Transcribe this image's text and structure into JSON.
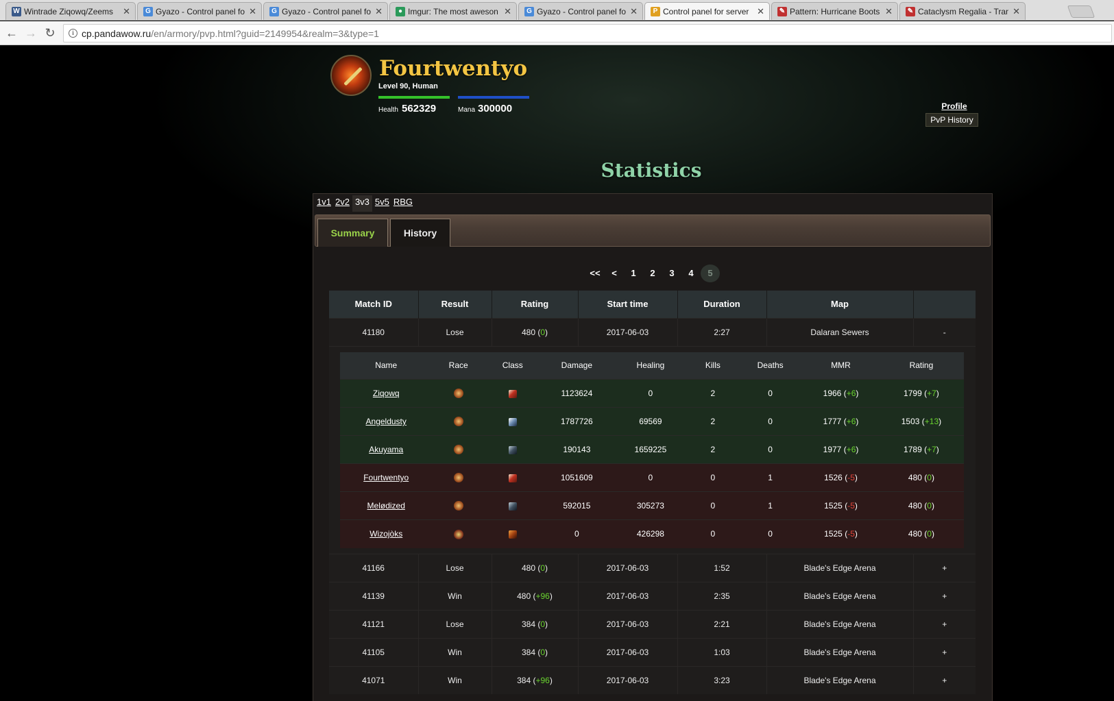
{
  "browser": {
    "tabs": [
      {
        "title": "Wintrade Ziqowq/Zeems",
        "favicon_color": "#3a5a8a",
        "glyph": "W",
        "active": false
      },
      {
        "title": "Gyazo - Control panel fo",
        "favicon_color": "#4a8ad8",
        "glyph": "G",
        "active": false
      },
      {
        "title": "Gyazo - Control panel fo",
        "favicon_color": "#4a8ad8",
        "glyph": "G",
        "active": false
      },
      {
        "title": "Imgur: The most aweson",
        "favicon_color": "#2a9a5a",
        "glyph": "●",
        "active": false
      },
      {
        "title": "Gyazo - Control panel fo",
        "favicon_color": "#4a8ad8",
        "glyph": "G",
        "active": false
      },
      {
        "title": "Control panel for server",
        "favicon_color": "#e0a020",
        "glyph": "P",
        "active": true
      },
      {
        "title": "Pattern: Hurricane Boots",
        "favicon_color": "#c03030",
        "glyph": "✎",
        "active": false
      },
      {
        "title": "Cataclysm Regalia - Tran",
        "favicon_color": "#c03030",
        "glyph": "✎",
        "active": false
      }
    ],
    "url_host": "cp.pandawow.ru",
    "url_path": "/en/armory/pvp.html?guid=2149954&realm=3&type=1"
  },
  "character": {
    "name": "Fourtwentyo",
    "subtitle": "Level 90, Human",
    "health_label": "Health",
    "health_value": "562329",
    "mana_label": "Mana",
    "mana_value": "300000"
  },
  "side_nav": {
    "profile": "Profile",
    "pvp_history": "PvP History"
  },
  "statistics_title": "Statistics",
  "brackets": [
    "1v1",
    "2v2",
    "3v3",
    "5v5",
    "RBG"
  ],
  "active_bracket": "3v3",
  "view_tabs": {
    "summary": "Summary",
    "history": "History"
  },
  "pager": {
    "first": "<<",
    "prev": "<",
    "pages": [
      "1",
      "2",
      "3",
      "4",
      "5"
    ],
    "current": "5"
  },
  "matches_table": {
    "headers": [
      "Match ID",
      "Result",
      "Rating",
      "Start time",
      "Duration",
      "Map",
      ""
    ],
    "expanded": {
      "id": "41180",
      "result": "Lose",
      "rating": "480",
      "rating_change": "0",
      "start": "2017-06-03",
      "duration": "2:27",
      "map": "Dalaran Sewers",
      "toggle": "-"
    },
    "player_headers": [
      "Name",
      "Race",
      "Class",
      "Damage",
      "Healing",
      "Kills",
      "Deaths",
      "MMR",
      "Rating"
    ],
    "players": [
      {
        "name": "Ziqowq",
        "team": "win",
        "race_icon": "human-male-icon",
        "class_icon": "warrior-icon",
        "damage": "1123624",
        "healing": "0",
        "kills": "2",
        "deaths": "0",
        "mmr": "1966",
        "mmr_change": "+6",
        "rating": "1799",
        "rating_change": "+7"
      },
      {
        "name": "Angeldusty",
        "team": "win",
        "race_icon": "human-male-icon",
        "class_icon": "paladin-icon",
        "damage": "1787726",
        "healing": "69569",
        "kills": "2",
        "deaths": "0",
        "mmr": "1777",
        "mmr_change": "+6",
        "rating": "1503",
        "rating_change": "+13"
      },
      {
        "name": "Akuyama",
        "team": "win",
        "race_icon": "human-male-icon",
        "class_icon": "shaman-icon",
        "damage": "190143",
        "healing": "1659225",
        "kills": "2",
        "deaths": "0",
        "mmr": "1977",
        "mmr_change": "+6",
        "rating": "1789",
        "rating_change": "+7"
      },
      {
        "name": "Fourtwentyo",
        "team": "loss",
        "race_icon": "human-male-icon",
        "class_icon": "warrior-icon",
        "damage": "1051609",
        "healing": "0",
        "kills": "0",
        "deaths": "1",
        "mmr": "1526",
        "mmr_change": "-5",
        "rating": "480",
        "rating_change": "0"
      },
      {
        "name": "Melødized",
        "team": "loss",
        "race_icon": "human-male-icon",
        "class_icon": "shaman-icon",
        "damage": "592015",
        "healing": "305273",
        "kills": "0",
        "deaths": "1",
        "mmr": "1525",
        "mmr_change": "-5",
        "rating": "480",
        "rating_change": "0"
      },
      {
        "name": "Wizojòks",
        "team": "loss",
        "race_icon": "orc-icon",
        "class_icon": "druid-icon",
        "damage": "0",
        "healing": "426298",
        "kills": "0",
        "deaths": "0",
        "mmr": "1525",
        "mmr_change": "-5",
        "rating": "480",
        "rating_change": "0"
      }
    ],
    "rows": [
      {
        "id": "41166",
        "result": "Lose",
        "rating": "480",
        "rating_change": "0",
        "start": "2017-06-03",
        "duration": "1:52",
        "map": "Blade's Edge Arena",
        "toggle": "+"
      },
      {
        "id": "41139",
        "result": "Win",
        "rating": "480",
        "rating_change": "+96",
        "start": "2017-06-03",
        "duration": "2:35",
        "map": "Blade's Edge Arena",
        "toggle": "+"
      },
      {
        "id": "41121",
        "result": "Lose",
        "rating": "384",
        "rating_change": "0",
        "start": "2017-06-03",
        "duration": "2:21",
        "map": "Blade's Edge Arena",
        "toggle": "+"
      },
      {
        "id": "41105",
        "result": "Win",
        "rating": "384",
        "rating_change": "0",
        "start": "2017-06-03",
        "duration": "1:03",
        "map": "Blade's Edge Arena",
        "toggle": "+"
      },
      {
        "id": "41071",
        "result": "Win",
        "rating": "384",
        "rating_change": "+96",
        "start": "2017-06-03",
        "duration": "3:23",
        "map": "Blade's Edge Arena",
        "toggle": "+"
      }
    ]
  }
}
